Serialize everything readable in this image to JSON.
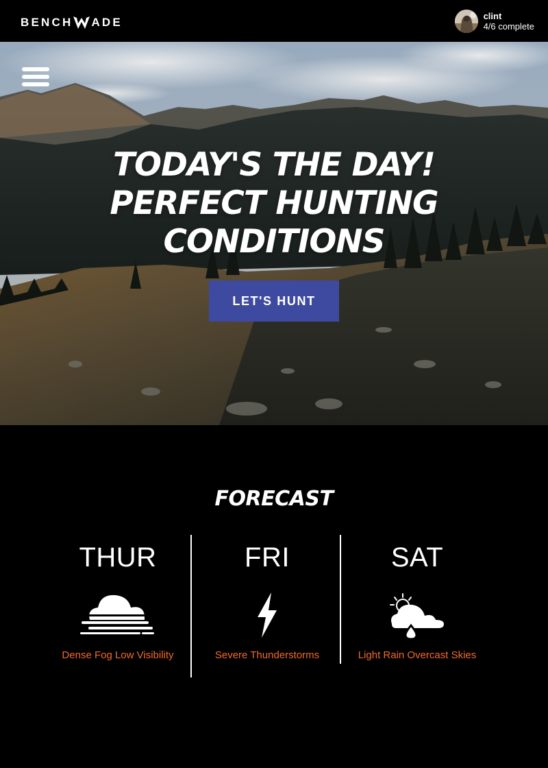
{
  "header": {
    "logo_left": "BENCH",
    "logo_right": "ADE",
    "user": {
      "name": "clint",
      "progress": "4/6 complete"
    }
  },
  "hero": {
    "title_lines": [
      "TODAY'S THE DAY!",
      "PERFECT HUNTING",
      "CONDITIONS"
    ],
    "cta_label": "LET'S HUNT",
    "cta_color": "#3e4aa0"
  },
  "forecast": {
    "title": "FORECAST",
    "accent_color": "#f26a2e",
    "days": [
      {
        "day": "THUR",
        "condition": "Dense Fog Low Visibility",
        "icon": "fog-icon"
      },
      {
        "day": "FRI",
        "condition": "Severe Thunderstorms",
        "icon": "lightning-icon"
      },
      {
        "day": "SAT",
        "condition": "Light Rain Overcast Skies",
        "icon": "partly-cloudy-rain-icon"
      }
    ]
  }
}
